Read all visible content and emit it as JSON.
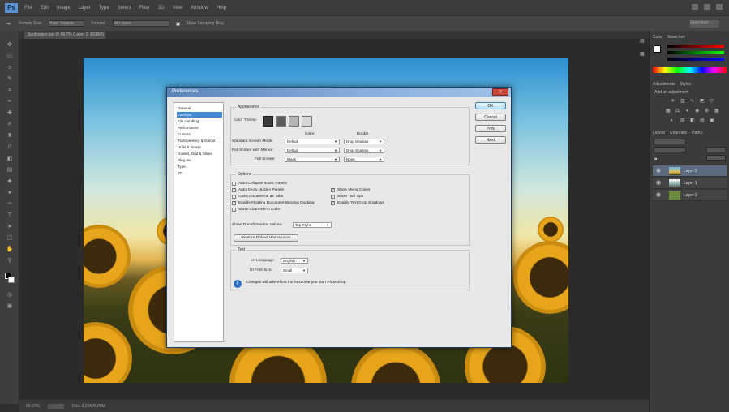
{
  "menubar": {
    "logo": "Ps",
    "items": [
      "File",
      "Edit",
      "Image",
      "Layer",
      "Type",
      "Select",
      "Filter",
      "3D",
      "View",
      "Window",
      "Help"
    ]
  },
  "optionsbar": {
    "sample_size_label": "Sample Size:",
    "sample_size_value": "Point Sample",
    "sample_label": "Sample:",
    "sample_value": "All Layers",
    "show_ring_label": "Show Sampling Ring",
    "workspace": "Essentials"
  },
  "document": {
    "tab_label": "Sunflowers.jpg @ 66.7% (Layer 2, RGB/8)"
  },
  "statusbar": {
    "zoom": "66.67%",
    "doc_info": "Doc: 2.25M/6.80M"
  },
  "panels": {
    "color_tabs": [
      "Color",
      "Swatches"
    ],
    "adjustments_tabs": [
      "Adjustments",
      "Styles"
    ],
    "adjustments_title": "Add an adjustment",
    "layers_tabs": [
      "Layers",
      "Channels",
      "Paths"
    ],
    "layers": [
      {
        "name": "Layer 2",
        "active": true
      },
      {
        "name": "Layer 1",
        "active": false
      },
      {
        "name": "Layer 3",
        "active": false
      }
    ]
  },
  "dialog": {
    "title": "Preferences",
    "categories": [
      "General",
      "Interface",
      "File Handling",
      "Performance",
      "Cursors",
      "Transparency & Gamut",
      "Units & Rulers",
      "Guides, Grid & Slices",
      "Plug-Ins",
      "Type",
      "3D"
    ],
    "selected_category": "Interface",
    "buttons": {
      "ok": "OK",
      "cancel": "Cancel",
      "prev": "Prev",
      "next": "Next"
    },
    "appearance": {
      "title": "Appearance",
      "color_theme_label": "Color Theme:",
      "col_color": "Color",
      "col_border": "Border",
      "rows": [
        {
          "label": "Standard Screen Mode:",
          "color": "Default",
          "border": "Drop Shadow"
        },
        {
          "label": "Full Screen with Menus:",
          "color": "Default",
          "border": "Drop Shadow"
        },
        {
          "label": "Full Screen:",
          "color": "Black",
          "border": "None"
        }
      ],
      "theme_colors": [
        "#3b3b3b",
        "#5c5c5c",
        "#b5b5b5",
        "#d6d6d6"
      ]
    },
    "options": {
      "title": "Options",
      "checkboxes_left": [
        {
          "label": "Auto-Collapse Iconic Panels",
          "checked": false
        },
        {
          "label": "Auto-Show Hidden Panels",
          "checked": true
        },
        {
          "label": "Open Documents as Tabs",
          "checked": true
        },
        {
          "label": "Enable Floating Document Window Docking",
          "checked": true
        },
        {
          "label": "Show Channels in Color",
          "checked": false
        }
      ],
      "checkboxes_right": [
        {
          "label": "Show Menu Colors",
          "checked": true
        },
        {
          "label": "Show Tool Tips",
          "checked": true
        },
        {
          "label": "Enable Text Drop Shadows",
          "checked": true
        }
      ],
      "transform_label": "Show Transformation Values:",
      "transform_value": "Top Right",
      "reset_button": "Restore Default Workspaces"
    },
    "text": {
      "title": "Text",
      "ui_language_label": "UI Language:",
      "ui_language_value": "English",
      "ui_font_size_label": "UI Font Size:",
      "ui_font_size_value": "Small",
      "note": "Changes will take effect the next time you start Photoshop."
    }
  }
}
